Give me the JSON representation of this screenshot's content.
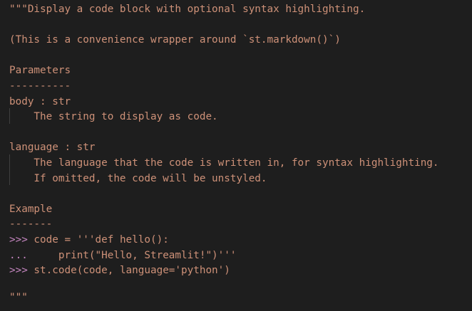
{
  "editor": {
    "lines": [
      "\"\"\"Display a code block with optional syntax highlighting.",
      "",
      "(This is a convenience wrapper around `st.markdown()`)",
      "",
      "Parameters",
      "----------",
      "body : str",
      "    The string to display as code.",
      "",
      "language : str",
      "    The language that the code is written in, for syntax highlighting.",
      "    If omitted, the code will be unstyled.",
      "",
      "Example",
      "-------",
      "",
      "",
      "",
      "",
      "\"\"\""
    ],
    "doctest": {
      "line1_prompt": ">>>",
      "line1_code": " code = '''def hello():",
      "line2_prompt": "...",
      "line2_code": "     print(\"Hello, Streamlit!\")'''",
      "line3_prompt": ">>>",
      "line3_code": " st.code(code, language='python')"
    }
  },
  "colors": {
    "background": "#1e1e1e",
    "string": "#ce9178",
    "prompt": "#c586c0",
    "indent_guide": "#404040"
  }
}
